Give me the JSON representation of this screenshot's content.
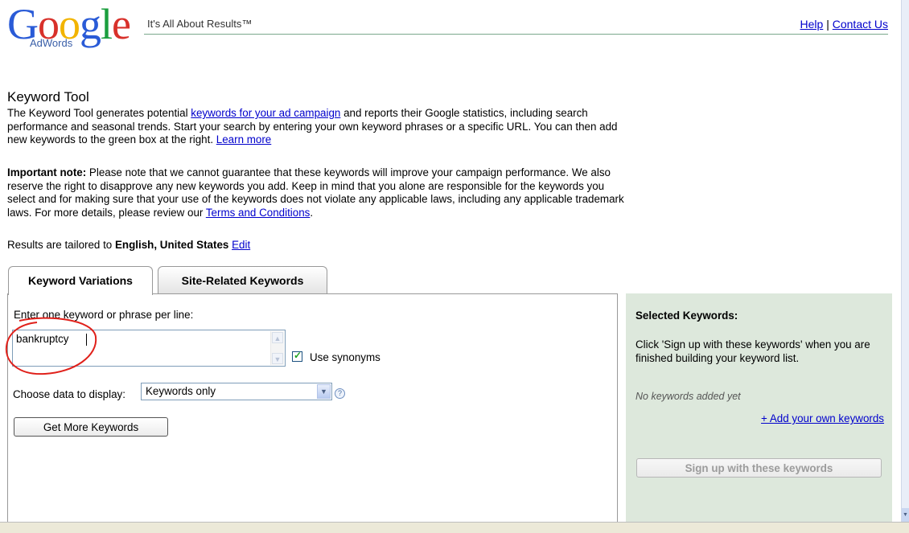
{
  "header": {
    "logo_text": "Google",
    "logo_subtext": "AdWords",
    "tagline": "It's All About Results™",
    "help_link": "Help",
    "separator": "|",
    "contact_link": "Contact Us"
  },
  "intro": {
    "title": "Keyword Tool",
    "p1_a": "The Keyword Tool generates potential ",
    "p1_link": "keywords for your ad campaign",
    "p1_b": " and reports their Google statistics, including search performance and seasonal trends. Start your search by entering your own keyword phrases or a specific URL. You can then add new keywords to the green box at the right. ",
    "p1_learn": "Learn more",
    "p2_bold": "Important note:",
    "p2_text": " Please note that we cannot guarantee that these keywords will improve your campaign performance. We also reserve the right to disapprove any new keywords you add. Keep in mind that you alone are responsible for the keywords you select and for making sure that your use of the keywords does not violate any applicable laws, including any applicable trademark laws. For more details, please review our ",
    "p2_link": "Terms and Conditions",
    "p2_end": ".",
    "results_prefix": "Results are tailored to ",
    "results_bold": "English, United States",
    "results_edit": "Edit"
  },
  "tabs": [
    {
      "label": "Keyword Variations",
      "active": true
    },
    {
      "label": "Site-Related Keywords",
      "active": false
    }
  ],
  "form": {
    "enter_label": "Enter one keyword or phrase per line:",
    "keyword_value": "bankruptcy",
    "use_synonyms_label": "Use synonyms",
    "use_synonyms_checked": true,
    "choose_label": "Choose data to display:",
    "display_selected": "Keywords only",
    "get_more_button": "Get More Keywords"
  },
  "selected_panel": {
    "title": "Selected Keywords:",
    "description": "Click 'Sign up with these keywords' when you are finished building your keyword list.",
    "empty_text": "No keywords added yet",
    "add_link": "+ Add your own keywords",
    "signup_button": "Sign up with these keywords"
  },
  "colors": {
    "link": "#0000cc",
    "selected_panel_bg": "#dde8dc",
    "annotation_circle": "#e0201a"
  }
}
